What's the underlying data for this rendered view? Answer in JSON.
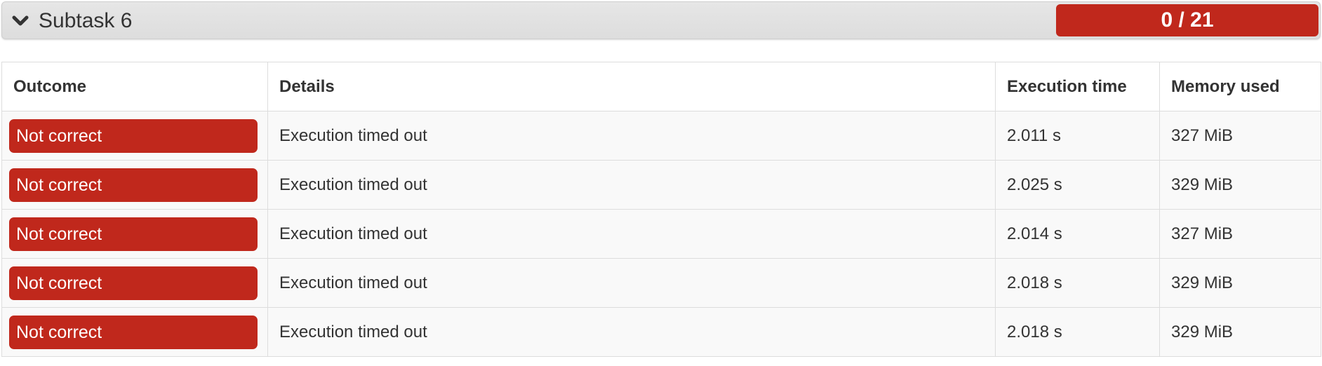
{
  "subtask": {
    "title": "Subtask 6",
    "score": "0 / 21"
  },
  "table": {
    "columns": [
      "Outcome",
      "Details",
      "Execution time",
      "Memory used"
    ],
    "rows": [
      {
        "outcome": "Not correct",
        "details": "Execution timed out",
        "time": "2.011 s",
        "memory": "327 MiB"
      },
      {
        "outcome": "Not correct",
        "details": "Execution timed out",
        "time": "2.025 s",
        "memory": "329 MiB"
      },
      {
        "outcome": "Not correct",
        "details": "Execution timed out",
        "time": "2.014 s",
        "memory": "327 MiB"
      },
      {
        "outcome": "Not correct",
        "details": "Execution timed out",
        "time": "2.018 s",
        "memory": "329 MiB"
      },
      {
        "outcome": "Not correct",
        "details": "Execution timed out",
        "time": "2.018 s",
        "memory": "329 MiB"
      }
    ]
  },
  "colors": {
    "error_red": "#c0281c",
    "header_gray": "#e0e0e0"
  },
  "icons": {
    "toggle": "chevron-down-icon"
  }
}
